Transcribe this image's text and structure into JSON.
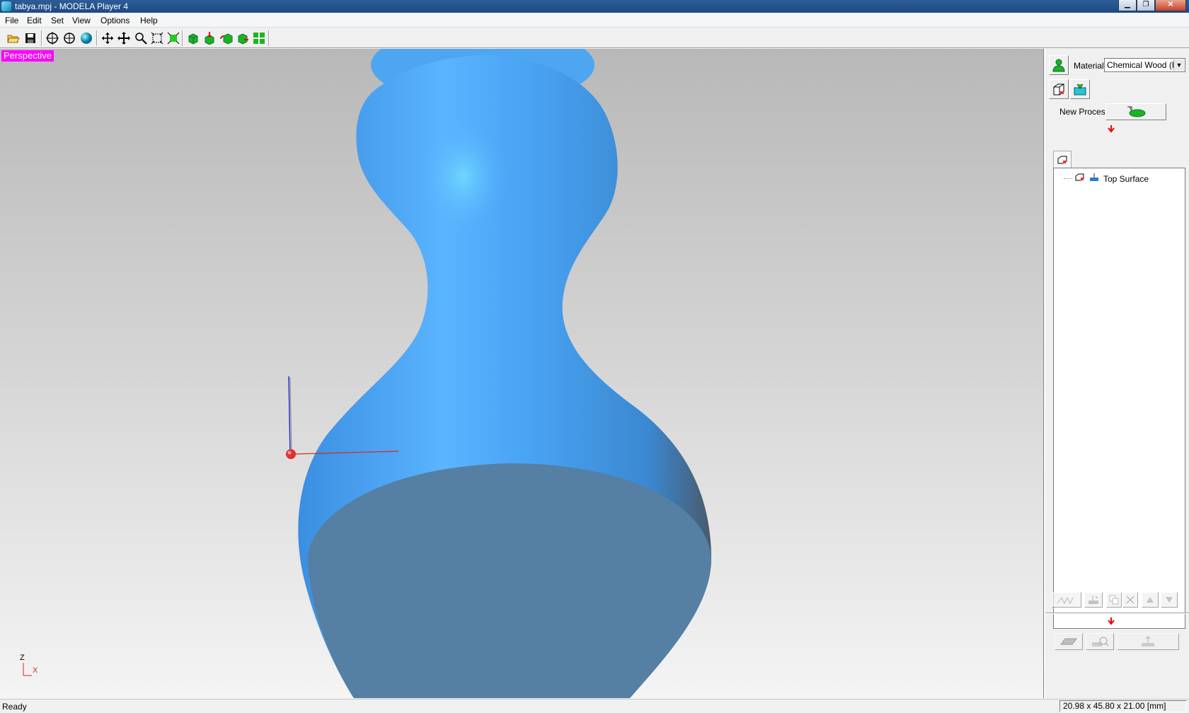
{
  "window": {
    "title": "tabya.mpj - MODELA Player 4"
  },
  "menu": [
    "File",
    "Edit",
    "Set",
    "View",
    "Options",
    "Help"
  ],
  "toolbar": [
    "open-icon",
    "save-icon",
    "view-center-icon",
    "view-fit-icon",
    "render-sphere-icon",
    "pan-icon",
    "move-icon",
    "zoom-icon",
    "zoom-window-icon",
    "fit-all-icon",
    "cut-model-icon",
    "cut-down-icon",
    "cut-rotate-icon",
    "cut-preview-icon",
    "layout-icon"
  ],
  "viewport": {
    "label": "Perspective",
    "label_bg": "#ff00ff",
    "model_color": "#4fa6f0",
    "axis_z": "Z",
    "axis_x": "X"
  },
  "panel": {
    "material_label": "Material",
    "material_value": "Chemical Wood (Ha",
    "new_process_label": "New Process",
    "tree_items": [
      "Top Surface"
    ]
  },
  "status": {
    "left": "Ready",
    "right": "20.98 x 45.80 x 21.00 [mm]"
  }
}
